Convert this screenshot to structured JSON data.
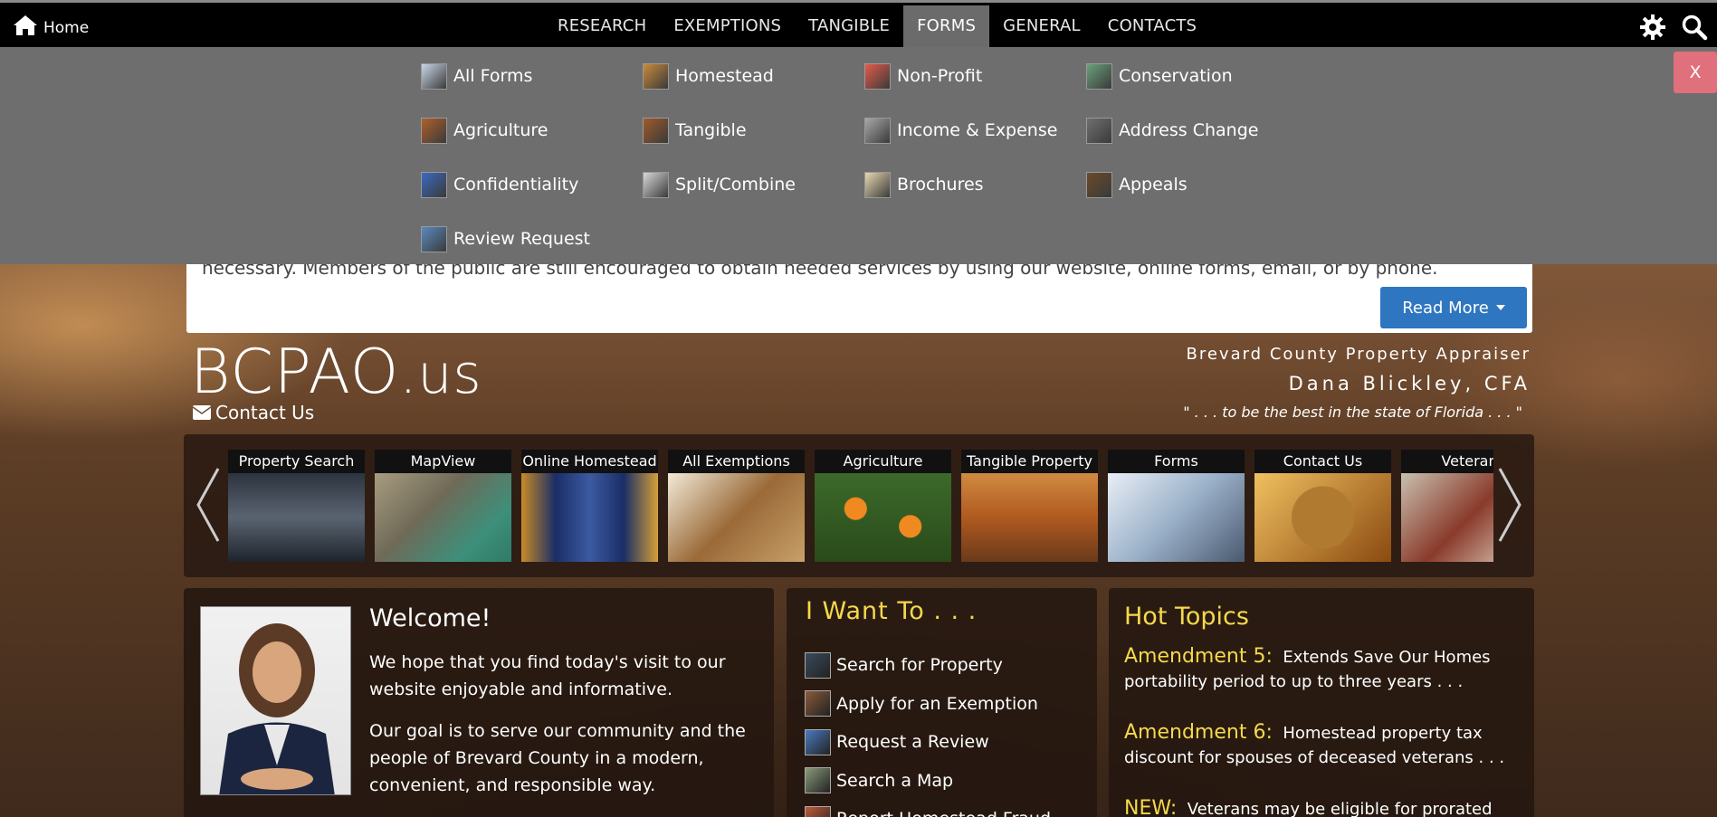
{
  "topnav": {
    "home_label": "Home",
    "items": [
      "RESEARCH",
      "EXEMPTIONS",
      "TANGIBLE",
      "FORMS",
      "GENERAL",
      "CONTACTS"
    ],
    "active": "FORMS"
  },
  "dropdown": {
    "close_label": "X",
    "items": [
      {
        "label": "All Forms",
        "icon": "all-forms-icon"
      },
      {
        "label": "Homestead",
        "icon": "homestead-icon"
      },
      {
        "label": "Non-Profit",
        "icon": "non-profit-icon"
      },
      {
        "label": "Conservation",
        "icon": "conservation-icon"
      },
      {
        "label": "Agriculture",
        "icon": "agriculture-icon"
      },
      {
        "label": "Tangible",
        "icon": "tangible-icon"
      },
      {
        "label": "Income & Expense",
        "icon": "income-expense-icon"
      },
      {
        "label": "Address Change",
        "icon": "address-change-icon"
      },
      {
        "label": "Confidentiality",
        "icon": "confidentiality-icon"
      },
      {
        "label": "Split/Combine",
        "icon": "split-combine-icon"
      },
      {
        "label": "Brochures",
        "icon": "brochures-icon"
      },
      {
        "label": "Appeals",
        "icon": "appeals-icon"
      },
      {
        "label": "Review Request",
        "icon": "review-request-icon"
      }
    ]
  },
  "alert": {
    "text": "necessary.   Members of the public are still encouraged to obtain needed services by using our website, online forms, email, or by phone.",
    "read_more": "Read More"
  },
  "header": {
    "brand_main": "BCPAO",
    "brand_suffix": ".us",
    "contact": "Contact Us",
    "title": "Brevard County Property Appraiser",
    "name": "Dana Blickley, CFA",
    "motto": "\" . . . to be the best in the state of Florida . . . \""
  },
  "carousel": {
    "tiles": [
      "Property Search",
      "MapView",
      "Online Homestead",
      "All Exemptions",
      "Agriculture",
      "Tangible Property",
      "Forms",
      "Contact Us",
      "Veteran"
    ]
  },
  "welcome": {
    "heading": "Welcome!",
    "p1": "We hope that you find today's visit to our website enjoyable and informative.",
    "p2": "Our goal is to serve our community and the people of Brevard County in a modern, convenient, and responsible way."
  },
  "iwant": {
    "heading": "I Want To . . .",
    "items": [
      "Search for Property",
      "Apply for an Exemption",
      "Request a Review",
      "Search a Map",
      "Report Homestead Fraud"
    ]
  },
  "hot": {
    "heading": "Hot Topics",
    "items": [
      {
        "key": "Amendment 5:",
        "text": "Extends Save Our Homes portability period to up to three years . . ."
      },
      {
        "key": "Amendment 6:",
        "text": "Homestead property tax discount for spouses of deceased veterans . . ."
      },
      {
        "key": "NEW:",
        "text": "Veterans may be eligible for prorated"
      }
    ]
  },
  "colors": {
    "accent_yellow": "#f5d94c",
    "button_blue": "#2f76c0",
    "close_pink": "#e0707c"
  }
}
